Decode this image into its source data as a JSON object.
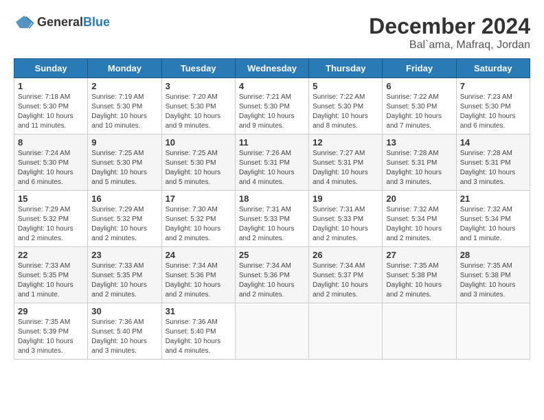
{
  "header": {
    "logo_general": "General",
    "logo_blue": "Blue",
    "month_title": "December 2024",
    "location": "Bal`ama, Mafraq, Jordan"
  },
  "days_of_week": [
    "Sunday",
    "Monday",
    "Tuesday",
    "Wednesday",
    "Thursday",
    "Friday",
    "Saturday"
  ],
  "weeks": [
    [
      {
        "day": "1",
        "sunrise": "7:18 AM",
        "sunset": "5:30 PM",
        "daylight": "10 hours and 11 minutes."
      },
      {
        "day": "2",
        "sunrise": "7:19 AM",
        "sunset": "5:30 PM",
        "daylight": "10 hours and 10 minutes."
      },
      {
        "day": "3",
        "sunrise": "7:20 AM",
        "sunset": "5:30 PM",
        "daylight": "10 hours and 9 minutes."
      },
      {
        "day": "4",
        "sunrise": "7:21 AM",
        "sunset": "5:30 PM",
        "daylight": "10 hours and 9 minutes."
      },
      {
        "day": "5",
        "sunrise": "7:22 AM",
        "sunset": "5:30 PM",
        "daylight": "10 hours and 8 minutes."
      },
      {
        "day": "6",
        "sunrise": "7:22 AM",
        "sunset": "5:30 PM",
        "daylight": "10 hours and 7 minutes."
      },
      {
        "day": "7",
        "sunrise": "7:23 AM",
        "sunset": "5:30 PM",
        "daylight": "10 hours and 6 minutes."
      }
    ],
    [
      {
        "day": "8",
        "sunrise": "7:24 AM",
        "sunset": "5:30 PM",
        "daylight": "10 hours and 6 minutes."
      },
      {
        "day": "9",
        "sunrise": "7:25 AM",
        "sunset": "5:30 PM",
        "daylight": "10 hours and 5 minutes."
      },
      {
        "day": "10",
        "sunrise": "7:25 AM",
        "sunset": "5:30 PM",
        "daylight": "10 hours and 5 minutes."
      },
      {
        "day": "11",
        "sunrise": "7:26 AM",
        "sunset": "5:31 PM",
        "daylight": "10 hours and 4 minutes."
      },
      {
        "day": "12",
        "sunrise": "7:27 AM",
        "sunset": "5:31 PM",
        "daylight": "10 hours and 4 minutes."
      },
      {
        "day": "13",
        "sunrise": "7:28 AM",
        "sunset": "5:31 PM",
        "daylight": "10 hours and 3 minutes."
      },
      {
        "day": "14",
        "sunrise": "7:28 AM",
        "sunset": "5:31 PM",
        "daylight": "10 hours and 3 minutes."
      }
    ],
    [
      {
        "day": "15",
        "sunrise": "7:29 AM",
        "sunset": "5:32 PM",
        "daylight": "10 hours and 2 minutes."
      },
      {
        "day": "16",
        "sunrise": "7:29 AM",
        "sunset": "5:32 PM",
        "daylight": "10 hours and 2 minutes."
      },
      {
        "day": "17",
        "sunrise": "7:30 AM",
        "sunset": "5:32 PM",
        "daylight": "10 hours and 2 minutes."
      },
      {
        "day": "18",
        "sunrise": "7:31 AM",
        "sunset": "5:33 PM",
        "daylight": "10 hours and 2 minutes."
      },
      {
        "day": "19",
        "sunrise": "7:31 AM",
        "sunset": "5:33 PM",
        "daylight": "10 hours and 2 minutes."
      },
      {
        "day": "20",
        "sunrise": "7:32 AM",
        "sunset": "5:34 PM",
        "daylight": "10 hours and 2 minutes."
      },
      {
        "day": "21",
        "sunrise": "7:32 AM",
        "sunset": "5:34 PM",
        "daylight": "10 hours and 1 minute."
      }
    ],
    [
      {
        "day": "22",
        "sunrise": "7:33 AM",
        "sunset": "5:35 PM",
        "daylight": "10 hours and 1 minute."
      },
      {
        "day": "23",
        "sunrise": "7:33 AM",
        "sunset": "5:35 PM",
        "daylight": "10 hours and 2 minutes."
      },
      {
        "day": "24",
        "sunrise": "7:34 AM",
        "sunset": "5:36 PM",
        "daylight": "10 hours and 2 minutes."
      },
      {
        "day": "25",
        "sunrise": "7:34 AM",
        "sunset": "5:36 PM",
        "daylight": "10 hours and 2 minutes."
      },
      {
        "day": "26",
        "sunrise": "7:34 AM",
        "sunset": "5:37 PM",
        "daylight": "10 hours and 2 minutes."
      },
      {
        "day": "27",
        "sunrise": "7:35 AM",
        "sunset": "5:38 PM",
        "daylight": "10 hours and 2 minutes."
      },
      {
        "day": "28",
        "sunrise": "7:35 AM",
        "sunset": "5:38 PM",
        "daylight": "10 hours and 3 minutes."
      }
    ],
    [
      {
        "day": "29",
        "sunrise": "7:35 AM",
        "sunset": "5:39 PM",
        "daylight": "10 hours and 3 minutes."
      },
      {
        "day": "30",
        "sunrise": "7:36 AM",
        "sunset": "5:40 PM",
        "daylight": "10 hours and 3 minutes."
      },
      {
        "day": "31",
        "sunrise": "7:36 AM",
        "sunset": "5:40 PM",
        "daylight": "10 hours and 4 minutes."
      },
      null,
      null,
      null,
      null
    ]
  ]
}
